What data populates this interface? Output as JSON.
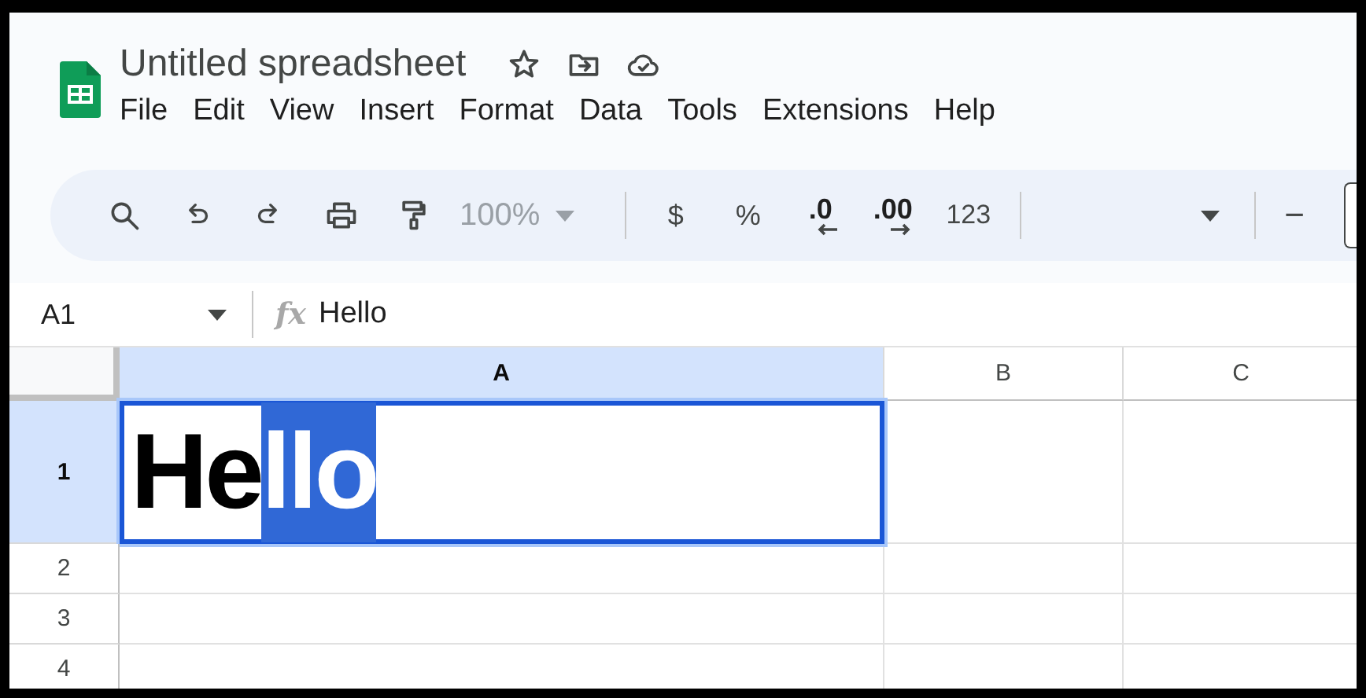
{
  "title": "Untitled spreadsheet",
  "menu": [
    "File",
    "Edit",
    "View",
    "Insert",
    "Format",
    "Data",
    "Tools",
    "Extensions",
    "Help"
  ],
  "toolbar": {
    "zoom": {
      "label": "100%",
      "disabled": true
    },
    "currency": "$",
    "percent": "%",
    "decrease_decimals": ".0",
    "increase_decimals": ".00",
    "number_format": "123",
    "minus": "−"
  },
  "formula_bar": {
    "cell_ref": "A1",
    "fx": "fx",
    "value": "Hello"
  },
  "grid": {
    "columns": [
      {
        "label": "A",
        "selected": true
      },
      {
        "label": "B",
        "selected": false
      },
      {
        "label": "C",
        "selected": false
      }
    ],
    "rows": [
      {
        "label": "1",
        "selected": true,
        "cells": [
          {
            "parts": [
              {
                "text": "He",
                "selected": false
              },
              {
                "text": "llo",
                "selected": true
              }
            ],
            "active": true
          }
        ]
      },
      {
        "label": "2",
        "selected": false
      },
      {
        "label": "3",
        "selected": false
      },
      {
        "label": "4",
        "selected": false
      }
    ]
  }
}
